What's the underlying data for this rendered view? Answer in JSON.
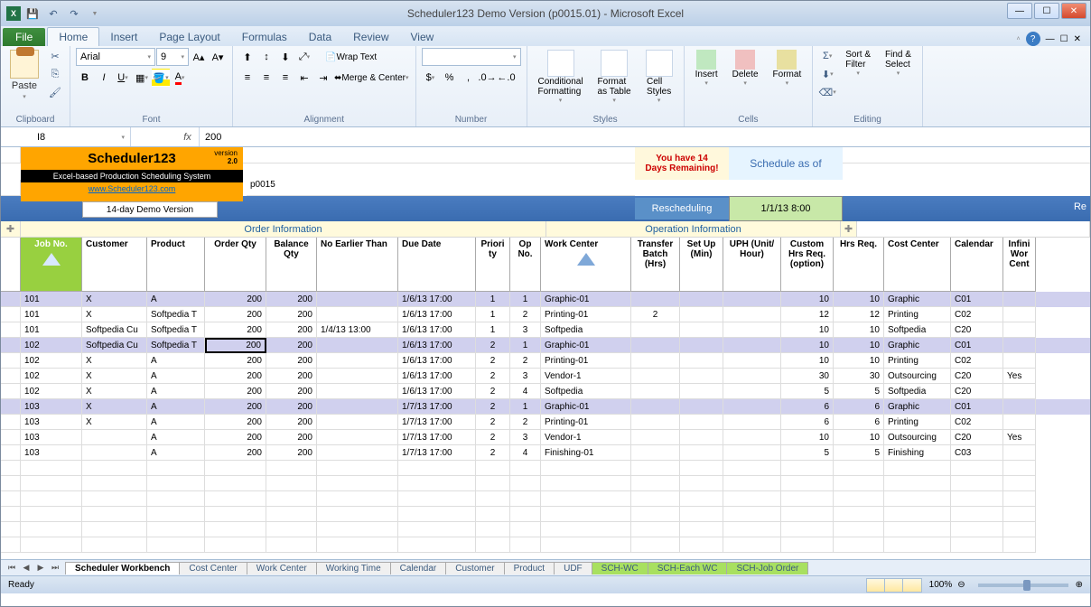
{
  "window": {
    "title": "Scheduler123 Demo Version (p0015.01)  -  Microsoft Excel",
    "app_short": "X"
  },
  "ribbon": {
    "tabs": [
      "File",
      "Home",
      "Insert",
      "Page Layout",
      "Formulas",
      "Data",
      "Review",
      "View"
    ],
    "active_tab": "Home",
    "font_name": "Arial",
    "font_size": "9",
    "num_format": "",
    "groups": {
      "clipboard": "Clipboard",
      "font": "Font",
      "alignment": "Alignment",
      "number": "Number",
      "styles": "Styles",
      "cells": "Cells",
      "editing": "Editing"
    },
    "buttons": {
      "paste": "Paste",
      "wrap": "Wrap Text",
      "merge": "Merge & Center",
      "cond_fmt": "Conditional\nFormatting",
      "fmt_table": "Format\nas Table",
      "cell_styles": "Cell\nStyles",
      "insert": "Insert",
      "delete": "Delete",
      "format": "Format",
      "sort": "Sort &\nFilter",
      "find": "Find &\nSelect"
    }
  },
  "formula_bar": {
    "name_box": "I8",
    "fx": "fx",
    "value": "200"
  },
  "scheduler": {
    "title": "Scheduler123",
    "version_label": "version",
    "version": "2.0",
    "subtitle": "Excel-based Production  Scheduling  System",
    "url": "www.Scheduler123.com",
    "p_name": "p0015",
    "demo_button": "14-day Demo Version",
    "warn_line1": "You  have 14",
    "warn_line2": "Days Remaining!",
    "schedule_as_of": "Schedule as of",
    "rescheduling": "Rescheduling",
    "asof_date": "1/1/13 8:00",
    "r_label": "Re",
    "section_order": "Order Information",
    "section_op": "Operation Information"
  },
  "columns": {
    "job": "Job No.",
    "customer": "Customer",
    "product": "Product",
    "order_qty": "Order Qty",
    "balance_qty": "Balance Qty",
    "no_earlier": "No Earlier Than",
    "due_date": "Due Date",
    "priority": "Priori ty",
    "op_no": "Op No.",
    "work_center": "Work Center",
    "transfer_batch": "Transfer Batch (Hrs)",
    "setup": "Set Up (Min)",
    "uph": "UPH (Unit/ Hour)",
    "custom_hrs": "Custom Hrs Req. (option)",
    "hrs_req": "Hrs Req.",
    "cost_center": "Cost Center",
    "calendar": "Calendar",
    "infini": "Infini Wor Cent"
  },
  "rows": [
    {
      "job": "101",
      "cust": "X",
      "prod": "A",
      "oq": "200",
      "bq": "200",
      "net": "",
      "due": "1/6/13 17:00",
      "pri": "1",
      "op": "1",
      "wc": "Graphic-01",
      "tb": "",
      "su": "",
      "uph": "",
      "chr": "10",
      "hrs": "10",
      "cc": "Graphic",
      "cal": "C01",
      "hl": true
    },
    {
      "job": "101",
      "cust": "X",
      "prod": "Softpedia T",
      "oq": "200",
      "bq": "200",
      "net": "",
      "due": "1/6/13 17:00",
      "pri": "1",
      "op": "2",
      "wc": "Printing-01",
      "tb": "2",
      "su": "",
      "uph": "",
      "chr": "12",
      "hrs": "12",
      "cc": "Printing",
      "cal": "C02",
      "hl": false
    },
    {
      "job": "101",
      "cust": "Softpedia Cu",
      "prod": "Softpedia T",
      "oq": "200",
      "bq": "200",
      "net": "1/4/13 13:00",
      "due": "1/6/13 17:00",
      "pri": "1",
      "op": "3",
      "wc": "Softpedia",
      "tb": "",
      "su": "",
      "uph": "",
      "chr": "10",
      "hrs": "10",
      "cc": "Softpedia",
      "cal": "C20",
      "hl": false
    },
    {
      "job": "102",
      "cust": "Softpedia Cu",
      "prod": "Softpedia T",
      "oq": "200",
      "bq": "200",
      "net": "",
      "due": "1/6/13 17:00",
      "pri": "2",
      "op": "1",
      "wc": "Graphic-01",
      "tb": "",
      "su": "",
      "uph": "",
      "chr": "10",
      "hrs": "10",
      "cc": "Graphic",
      "cal": "C01",
      "hl": true,
      "active": true
    },
    {
      "job": "102",
      "cust": "X",
      "prod": "A",
      "oq": "200",
      "bq": "200",
      "net": "",
      "due": "1/6/13 17:00",
      "pri": "2",
      "op": "2",
      "wc": "Printing-01",
      "tb": "",
      "su": "",
      "uph": "",
      "chr": "10",
      "hrs": "10",
      "cc": "Printing",
      "cal": "C02",
      "hl": false
    },
    {
      "job": "102",
      "cust": "X",
      "prod": "A",
      "oq": "200",
      "bq": "200",
      "net": "",
      "due": "1/6/13 17:00",
      "pri": "2",
      "op": "3",
      "wc": "Vendor-1",
      "tb": "",
      "su": "",
      "uph": "",
      "chr": "30",
      "hrs": "30",
      "cc": "Outsourcing",
      "cal": "C20",
      "iwc": "Yes",
      "hl": false
    },
    {
      "job": "102",
      "cust": "X",
      "prod": "A",
      "oq": "200",
      "bq": "200",
      "net": "",
      "due": "1/6/13 17:00",
      "pri": "2",
      "op": "4",
      "wc": "Softpedia",
      "tb": "",
      "su": "",
      "uph": "",
      "chr": "5",
      "hrs": "5",
      "cc": "Softpedia",
      "cal": "C20",
      "hl": false
    },
    {
      "job": "103",
      "cust": "X",
      "prod": "A",
      "oq": "200",
      "bq": "200",
      "net": "",
      "due": "1/7/13 17:00",
      "pri": "2",
      "op": "1",
      "wc": "Graphic-01",
      "tb": "",
      "su": "",
      "uph": "",
      "chr": "6",
      "hrs": "6",
      "cc": "Graphic",
      "cal": "C01",
      "hl": true
    },
    {
      "job": "103",
      "cust": "X",
      "prod": "A",
      "oq": "200",
      "bq": "200",
      "net": "",
      "due": "1/7/13 17:00",
      "pri": "2",
      "op": "2",
      "wc": "Printing-01",
      "tb": "",
      "su": "",
      "uph": "",
      "chr": "6",
      "hrs": "6",
      "cc": "Printing",
      "cal": "C02",
      "hl": false
    },
    {
      "job": "103",
      "cust": "",
      "prod": "A",
      "oq": "200",
      "bq": "200",
      "net": "",
      "due": "1/7/13 17:00",
      "pri": "2",
      "op": "3",
      "wc": "Vendor-1",
      "tb": "",
      "su": "",
      "uph": "",
      "chr": "10",
      "hrs": "10",
      "cc": "Outsourcing",
      "cal": "C20",
      "iwc": "Yes",
      "hl": false
    },
    {
      "job": "103",
      "cust": "",
      "prod": "A",
      "oq": "200",
      "bq": "200",
      "net": "",
      "due": "1/7/13 17:00",
      "pri": "2",
      "op": "4",
      "wc": "Finishing-01",
      "tb": "",
      "su": "",
      "uph": "",
      "chr": "5",
      "hrs": "5",
      "cc": "Finishing",
      "cal": "C03",
      "hl": false
    }
  ],
  "sheet_tabs": [
    "Scheduler Workbench",
    "Cost Center",
    "Work Center",
    "Working Time",
    "Calendar",
    "Customer",
    "Product",
    "UDF",
    "SCH-WC",
    "SCH-Each WC",
    "SCH-Job Order"
  ],
  "status": {
    "ready": "Ready",
    "zoom": "100%"
  }
}
